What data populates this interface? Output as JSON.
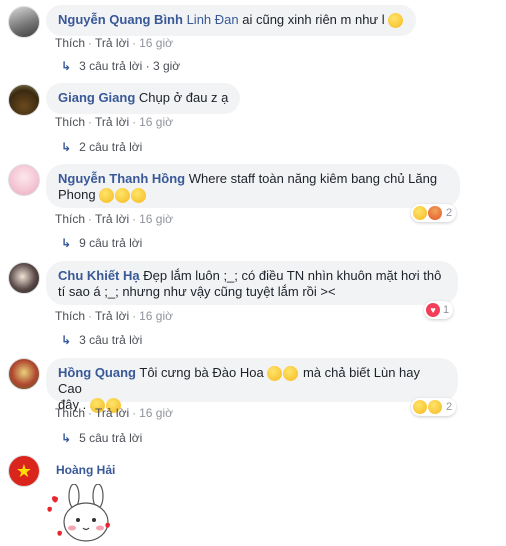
{
  "comments": [
    {
      "name": "Nguyễn Quang Bình",
      "mention": "Linh Đan",
      "text": " ai cũng xinh riên m như l",
      "like": "Thích",
      "reply": "Trả lời",
      "time": "16 giờ",
      "replies": "3 câu trả lời · 3 giờ"
    },
    {
      "name": "Giang Giang",
      "text": " Chụp ở đau z ạ",
      "like": "Thích",
      "reply": "Trả lời",
      "time": "16 giờ",
      "replies": "2 câu trả lời"
    },
    {
      "name": "Nguyễn Thanh Hồng",
      "text": " Where staff toàn năng kiêm bang chủ Lăng",
      "text2": "Phong",
      "like": "Thích",
      "reply": "Trả lời",
      "time": "16 giờ",
      "replies": "9 câu trả lời",
      "reaction_count": "2"
    },
    {
      "name": "Chu Khiết Hạ",
      "text": " Đẹp lắm luôn ;_; có điều TN nhìn khuôn mặt hơi thô",
      "text2": "tí sao á ;_; nhưng như vậy cũng tuyệt lắm rồi ><",
      "like": "Thích",
      "reply": "Trả lời",
      "time": "16 giờ",
      "replies": "3 câu trả lời",
      "reaction_count": "1"
    },
    {
      "name": "Hồng Quang",
      "text": " Tôi cưng bà Đào Hoa",
      "text_b": " mà chả biết Lùn hay Cao",
      "text2": "đây .",
      "like": "Thích",
      "reply": "Trả lời",
      "time": "16 giờ",
      "replies": "5 câu trả lời",
      "reaction_count": "2"
    },
    {
      "name": "Hoàng Hải"
    }
  ],
  "icons": {
    "reply_arrow": "reply-arrow-icon",
    "sticker": "bunny-sticker"
  },
  "colors": {
    "name": "#385898",
    "bubble": "#f2f3f5",
    "meta": "#90949c",
    "heart": "#f33e58"
  }
}
